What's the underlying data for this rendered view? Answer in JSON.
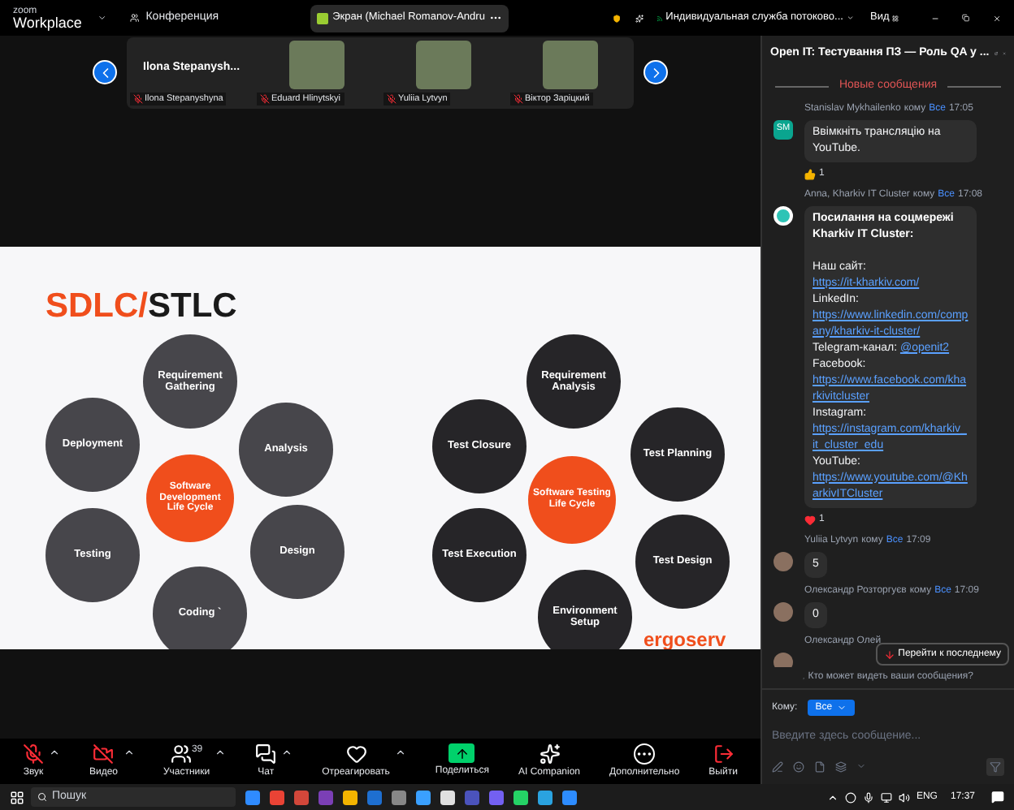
{
  "top_bar": {
    "logo_small": "zoom",
    "logo_large": "Workplace",
    "meeting_label": "Конференция",
    "screen_pill": "Экран (Michael Romanov-Andru",
    "stream_label": "Индивидуальная служба потоково...",
    "view_label": "Вид"
  },
  "thumbnails": {
    "name_tile": {
      "title": "Ilona  Stepanysh...",
      "name": "Ilona Stepanyshyna",
      "muted": true
    },
    "tiles": [
      {
        "name": "Eduard Hlinytskyi",
        "muted": true
      },
      {
        "name": "Yuliia Lytvyn",
        "muted": true
      },
      {
        "name": "Віктор Зарiцкий",
        "muted": true
      }
    ]
  },
  "slide": {
    "title_accent": "SDLC/",
    "title_rest": "STLC",
    "logo": "ergoserv",
    "cycles": [
      {
        "center": "Software Development Life Cycle",
        "color": "#47464b",
        "stages": [
          "Requirement Gathering",
          "Analysis",
          "Design",
          "Coding `",
          "Testing",
          "Deployment"
        ]
      },
      {
        "center": "Software Testing Life Cycle",
        "color": "#262528",
        "stages": [
          "Requirement Analysis",
          "Test Planning",
          "Test Design",
          "Environment Setup",
          "Test Execution",
          "Test Closure"
        ]
      }
    ]
  },
  "toolbar": [
    {
      "kind": "audio",
      "label": "Звук",
      "muted": true
    },
    {
      "kind": "video",
      "label": "Видео",
      "muted": true
    },
    {
      "kind": "participants",
      "label": "Участники",
      "count": "39"
    },
    {
      "kind": "chat",
      "label": "Чат"
    },
    {
      "kind": "react",
      "label": "Отреагировать"
    },
    {
      "kind": "share",
      "label": "Поделиться"
    },
    {
      "kind": "ai",
      "label": "AI Companion"
    },
    {
      "kind": "more",
      "label": "Дополнительно"
    },
    {
      "kind": "leave",
      "label": "Выйти"
    }
  ],
  "chat": {
    "title": "Open IT: Тестування ПЗ — Роль QA у ...",
    "divider": "Новые сообщения",
    "messages": [
      {
        "sender": "Stanislav Mykhailenko",
        "to": "кому",
        "audience": "Все",
        "time": "17:05",
        "avatar": {
          "kind": "initials",
          "text": "SM"
        },
        "body": [
          {
            "kind": "text",
            "text": "Ввімкніть трансляцію на YouTube."
          }
        ],
        "reaction": {
          "kind": "thumbs",
          "count": "1"
        }
      },
      {
        "sender": "Anna, Kharkiv IT Cluster",
        "to": "кому",
        "audience": "Все",
        "time": "17:08",
        "avatar": {
          "kind": "logo"
        },
        "body": [
          {
            "kind": "bold",
            "text": "Посилання на соцмережі Kharkiv IT Cluster:"
          },
          {
            "kind": "gap"
          },
          {
            "kind": "text",
            "text": "Наш сайт: ",
            "link": "https://it-kharkiv.com/"
          },
          {
            "kind": "text",
            "text": "LinkedIn:"
          },
          {
            "kind": "link",
            "text": "https://www.linkedin.com/company/kharkiv-it-cluster/"
          },
          {
            "kind": "text",
            "text": "Telegram-канал: ",
            "link": "@openit2"
          },
          {
            "kind": "text",
            "text": "Facebook:"
          },
          {
            "kind": "link",
            "text": "https://www.facebook.com/kharkivitcluster"
          },
          {
            "kind": "text",
            "text": "Instagram:"
          },
          {
            "kind": "link",
            "text": "https://instagram.com/kharkiv_it_cluster_edu"
          },
          {
            "kind": "text",
            "text": "YouTube:"
          },
          {
            "kind": "link",
            "text": "https://www.youtube.com/@KharkivITCluster"
          }
        ],
        "reaction": {
          "kind": "heart",
          "count": "1"
        }
      },
      {
        "sender": "Yuliia Lytvyn",
        "to": "кому",
        "audience": "Все",
        "time": "17:09",
        "avatar": {
          "kind": "photo"
        },
        "body": [
          {
            "kind": "text",
            "text": "5"
          }
        ]
      },
      {
        "sender": "Олександр Розторгуєв",
        "to": "кому",
        "audience": "Все",
        "time": "17:09",
        "avatar": {
          "kind": "photo"
        },
        "body": [
          {
            "kind": "text",
            "text": "0"
          }
        ]
      },
      {
        "sender": "Олександр Олей",
        "avatar": {
          "kind": "photo"
        }
      }
    ],
    "jump_button": "Перейти к последнему",
    "privacy_note": "Кто может видеть ваши сообщения?",
    "to_label": "Кому:",
    "to_value": "Все",
    "input": {
      "placeholder": "Введите здесь сообщение..."
    }
  },
  "taskbar": {
    "search_placeholder": "Пошук",
    "language": "ENG",
    "time": "17:37"
  }
}
